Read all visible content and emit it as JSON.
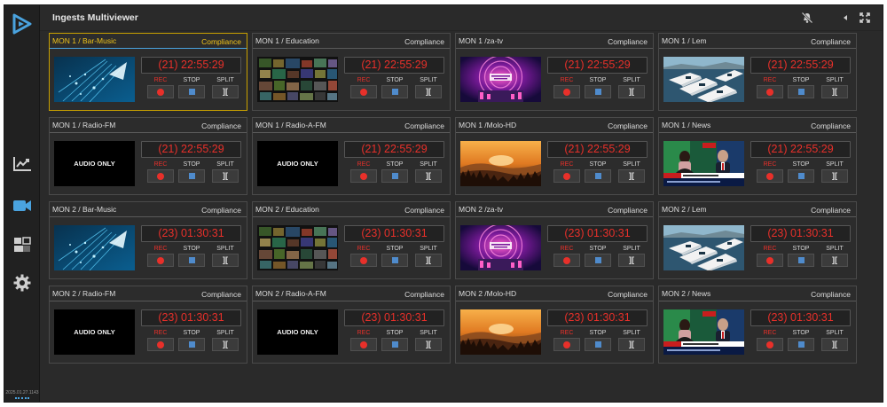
{
  "app": {
    "title": "Ingests Multiviewer",
    "version": "2025.01.27.1143",
    "accent_color": "#4aa3df",
    "selected_color": "#f0c419",
    "rec_color": "#e8302a"
  },
  "sidebar": {
    "items": [
      {
        "name": "statistics",
        "icon": "chart-line-icon"
      },
      {
        "name": "ingest",
        "icon": "video-camera-icon",
        "active": true
      },
      {
        "name": "multiviewer",
        "icon": "grid-layout-icon"
      },
      {
        "name": "settings",
        "icon": "gear-icon"
      }
    ]
  },
  "controls": {
    "rec_label": "REC",
    "stop_label": "STOP",
    "split_label": "SPLIT",
    "split_glyph": "][",
    "audio_only_label": "AUDIO ONLY",
    "compliance_label": "Compliance"
  },
  "channels": [
    {
      "name": "MON 1 / Bar-Music",
      "timer": "(21) 22:55:29",
      "thumb": "bar",
      "selected": true
    },
    {
      "name": "MON 1 / Education",
      "timer": "(21) 22:55:29",
      "thumb": "edu"
    },
    {
      "name": "MON 1 /za-tv",
      "timer": "(21) 22:55:29",
      "thumb": "za"
    },
    {
      "name": "MON 1 / Lem",
      "timer": "(21) 22:55:29",
      "thumb": "lem"
    },
    {
      "name": "MON 1 / Radio-FM",
      "timer": "(21) 22:55:29",
      "thumb": "audio"
    },
    {
      "name": "MON 1 / Radio-A-FM",
      "timer": "(21) 22:55:29",
      "thumb": "audio"
    },
    {
      "name": "MON 1 /Molo-HD",
      "timer": "(21) 22:55:29",
      "thumb": "molo"
    },
    {
      "name": "MON 1 / News",
      "timer": "(21) 22:55:29",
      "thumb": "news"
    },
    {
      "name": "MON 2 / Bar-Music",
      "timer": "(23) 01:30:31",
      "thumb": "bar"
    },
    {
      "name": "MON 2 / Education",
      "timer": "(23) 01:30:31",
      "thumb": "edu"
    },
    {
      "name": "MON 2 /za-tv",
      "timer": "(23) 01:30:31",
      "thumb": "za"
    },
    {
      "name": "MON 2 / Lem",
      "timer": "(23) 01:30:31",
      "thumb": "lem"
    },
    {
      "name": "MON 2 / Radio-FM",
      "timer": "(23) 01:30:31",
      "thumb": "audio"
    },
    {
      "name": "MON 2 / Radio-A-FM",
      "timer": "(23) 01:30:31",
      "thumb": "audio"
    },
    {
      "name": "MON 2 /Molo-HD",
      "timer": "(23) 01:30:31",
      "thumb": "molo"
    },
    {
      "name": "MON 2 / News",
      "timer": "(23) 01:30:31",
      "thumb": "news"
    }
  ]
}
